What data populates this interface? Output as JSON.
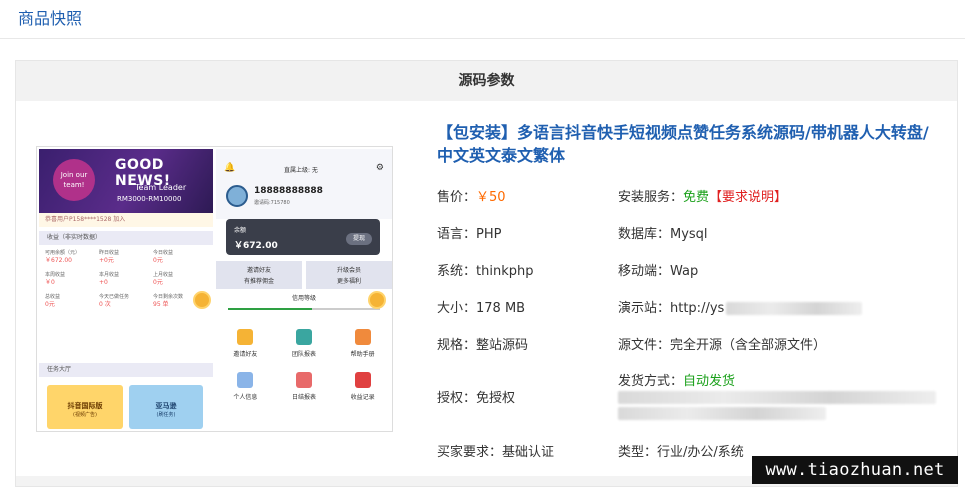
{
  "header": {
    "title": "商品快照"
  },
  "panel": {
    "title": "源码参数"
  },
  "product": {
    "title": "【包安装】多语言抖音快手短视频点赞任务系统源码/带机器人大转盘/中文英文泰文繁体"
  },
  "attrs": {
    "price_label": "售价：",
    "price_value": "￥50",
    "install_label": "安装服务：",
    "install_value": "免费",
    "install_link": "【要求说明】",
    "lang": "语言：PHP",
    "db": "数据库：Mysql",
    "system": "系统：thinkphp",
    "mobile": "移动端：Wap",
    "size": "大小：178 MB",
    "demo": "演示站：http://ys",
    "spec": "规格：整站源码",
    "source": "源文件：完全开源（含全部源文件）",
    "license": "授权：免授权",
    "delivery_label": "发货方式：",
    "delivery_value": "自动发货",
    "buyer": "买家要求：基础认证",
    "type": "类型：行业/办公/系统"
  },
  "thumb": {
    "join": "Join our team!",
    "good_news": "GOOD NEWS!",
    "team_leader": "Team Leader",
    "salary": "RM3000-RM10000",
    "notice": "恭喜用户P158****1528 加入",
    "income_header": "收益（非实时数据）",
    "cells": [
      {
        "label": "可用余额（元）",
        "value": "￥672.00"
      },
      {
        "label": "昨日收益",
        "value": "+0元"
      },
      {
        "label": "今日收益",
        "value": "0元"
      },
      {
        "label": "本周收益",
        "value": "￥0"
      },
      {
        "label": "本月收益",
        "value": "+0"
      },
      {
        "label": "上月收益",
        "value": "0元"
      },
      {
        "label": "总收益",
        "value": "0元"
      },
      {
        "label": "今天已做任务",
        "value": "0 次"
      },
      {
        "label": "今日剩余次数",
        "value": "95 单"
      }
    ],
    "task_header": "任务大厅",
    "card1": "抖音国际版",
    "card1_sub": "(视频广告)",
    "card2": "亚马逊",
    "card2_sub": "(刷任务)",
    "vip_line": "直属上级: 无",
    "phone_number": "18888888888",
    "invite_code": "邀请码:715780",
    "balance_label": "余额",
    "balance_amount": "￥672.00",
    "withdraw": "提现",
    "invite_btn": "邀请好友",
    "invite_sub": "有推荐佣金",
    "upgrade_btn": "升级会员",
    "upgrade_sub": "更多福利",
    "credit_title": "信用等级",
    "icons": [
      "邀请好友",
      "团队报表",
      "帮助手册",
      "个人信息",
      "日结报表",
      "收益记录"
    ]
  },
  "watermark": "www.tiaozhuan.net",
  "colors": {
    "link": "#1f5fb0",
    "price": "#ff6a00",
    "green": "#1aa01a",
    "red": "#e02020"
  }
}
